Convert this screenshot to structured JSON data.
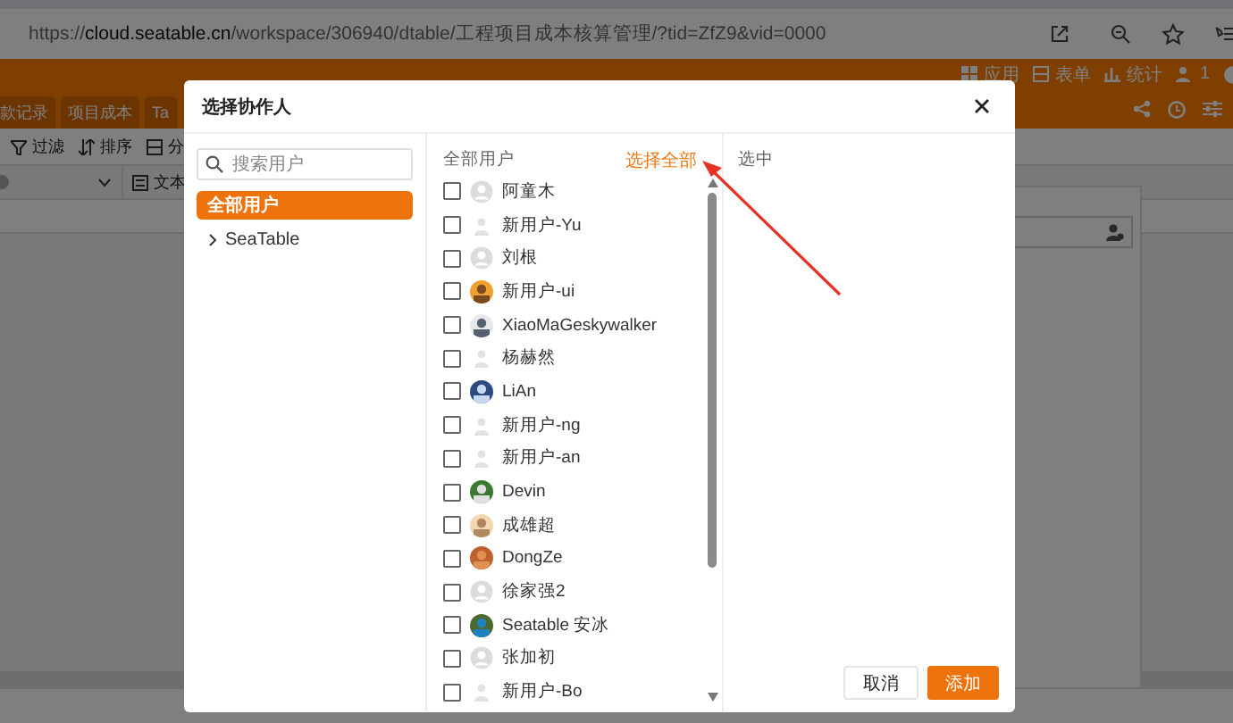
{
  "browser": {
    "url": "https://**cloud.seatable.cn**/workspace/306940/dtable/工程项目成本核算管理/?tid=ZfZ9&vid=0000"
  },
  "app": {
    "header_actions": [
      {
        "kind": "apps",
        "label": "应用"
      },
      {
        "kind": "form",
        "label": "表单"
      },
      {
        "kind": "stats",
        "label": "统计"
      },
      {
        "kind": "people",
        "label": "1"
      }
    ],
    "tabs": [
      {
        "label": "款记录"
      },
      {
        "label": "项目成本"
      },
      {
        "label": "Ta"
      }
    ],
    "toolbar": [
      {
        "kind": "filter",
        "label": "过滤"
      },
      {
        "kind": "sort",
        "label": "排序"
      },
      {
        "kind": "group",
        "label": "分"
      }
    ],
    "column_header": "文本"
  },
  "dialog": {
    "title": "选择协作人",
    "search": {
      "placeholder": "搜索用户"
    },
    "groups": [
      {
        "label": "全部用户",
        "selected": true,
        "kind": "all"
      },
      {
        "label": "SeaTable",
        "selected": false,
        "expanded": false,
        "kind": "team"
      }
    ],
    "list_title": "全部用户",
    "select_all": "选择全部",
    "selected_title": "选中",
    "users": [
      {
        "name": "阿童木",
        "checked": false,
        "kind": "default"
      },
      {
        "name": "新用户-Yu",
        "checked": false,
        "kind": "blank"
      },
      {
        "name": "刘根",
        "checked": false,
        "kind": "default"
      },
      {
        "name": "新用户-ui",
        "checked": false
      },
      {
        "name": "XiaoMaGeskywalker",
        "checked": false
      },
      {
        "name": "杨赫然",
        "checked": false,
        "kind": "blank"
      },
      {
        "name": "LiAn",
        "checked": false
      },
      {
        "name": "新用户-ng",
        "checked": false,
        "kind": "blank"
      },
      {
        "name": "新用户-an",
        "checked": false,
        "kind": "blank"
      },
      {
        "name": "Devin",
        "checked": false
      },
      {
        "name": "成雄超",
        "checked": false
      },
      {
        "name": "DongZe",
        "checked": false
      },
      {
        "name": "徐家强2",
        "checked": false,
        "kind": "default"
      },
      {
        "name": "Seatable 安冰",
        "checked": false
      },
      {
        "name": "张加初",
        "checked": false,
        "kind": "default"
      },
      {
        "name": "新用户-Bo",
        "checked": false,
        "kind": "blank"
      }
    ],
    "buttons": [
      {
        "kind": "cancel",
        "label": "取消"
      },
      {
        "kind": "primary",
        "label": "添加"
      }
    ]
  }
}
